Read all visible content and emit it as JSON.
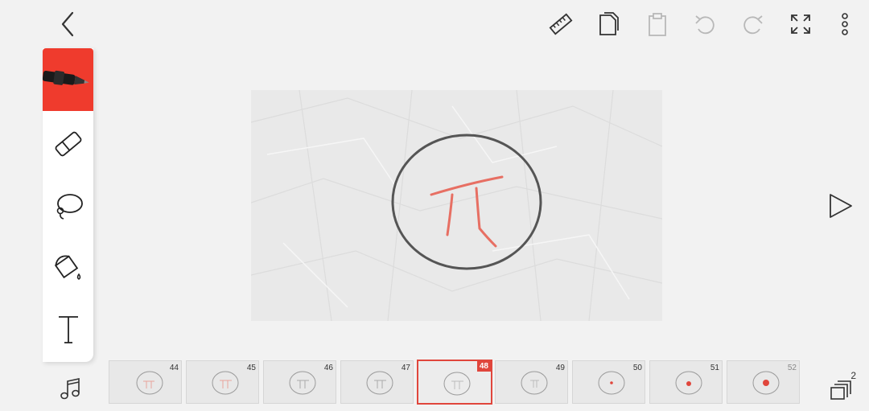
{
  "colors": {
    "accent": "#ef3b2d",
    "selected_frame": "#e0463c",
    "background": "#f2f2f2"
  },
  "toolbar": {
    "back": "chevron-left-icon",
    "actions": [
      "ruler-icon",
      "copy-icon",
      "paste-icon",
      "undo-icon",
      "redo-icon",
      "fullscreen-icon",
      "more-icon"
    ]
  },
  "tools": [
    "pen-icon",
    "eraser-icon",
    "lasso-icon",
    "fill-bucket-icon",
    "text-icon"
  ],
  "canvas": {
    "drawing": "circle with pi symbol"
  },
  "timeline": {
    "selected": "48",
    "frames": [
      {
        "num": "44"
      },
      {
        "num": "45"
      },
      {
        "num": "46"
      },
      {
        "num": "47"
      },
      {
        "num": "48"
      },
      {
        "num": "49"
      },
      {
        "num": "50"
      },
      {
        "num": "51"
      },
      {
        "num": "52"
      }
    ]
  },
  "layers": {
    "count": "2"
  }
}
